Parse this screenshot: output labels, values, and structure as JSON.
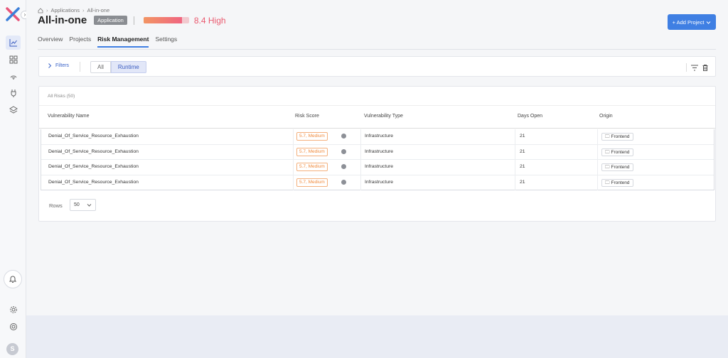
{
  "breadcrumb": {
    "items": [
      "Applications",
      "All-in-one"
    ]
  },
  "header": {
    "title": "All-in-one",
    "badge": "Application",
    "score_text": "8.4 High",
    "score_fraction": 0.84,
    "add_button": "+ Add Project"
  },
  "tabs": [
    {
      "label": "Overview"
    },
    {
      "label": "Projects"
    },
    {
      "label": "Risk Management",
      "active": true
    },
    {
      "label": "Settings"
    }
  ],
  "filters": {
    "label": "Filters",
    "segments": [
      "All",
      "Runtime"
    ],
    "active_segment": "Runtime"
  },
  "table": {
    "title": "All Risks (50)",
    "columns": [
      "Vulnerability Name",
      "Risk Score",
      "Vulnerability Type",
      "Days Open",
      "Origin"
    ],
    "rows": [
      {
        "name": "Denial_Of_Service_Resource_Exhaustion",
        "risk": "5.7, Medium",
        "type": "Infrastructure",
        "days": "21",
        "origin": "Frontend"
      },
      {
        "name": "Denial_Of_Service_Resource_Exhaustion",
        "risk": "5.7, Medium",
        "type": "Infrastructure",
        "days": "21",
        "origin": "Frontend"
      },
      {
        "name": "Denial_Of_Service_Resource_Exhaustion",
        "risk": "5.7, Medium",
        "type": "Infrastructure",
        "days": "21",
        "origin": "Frontend"
      },
      {
        "name": "Denial_Of_Service_Resource_Exhaustion",
        "risk": "5.7, Medium",
        "type": "Infrastructure",
        "days": "21",
        "origin": "Frontend"
      }
    ]
  },
  "pagination": {
    "rows_label": "Rows",
    "rows_value": "50"
  },
  "user": {
    "initial": "S"
  },
  "colors": {
    "accent": "#3f7fe3",
    "risk_high": "#ea5a6f",
    "risk_medium": "#f08a3c"
  }
}
